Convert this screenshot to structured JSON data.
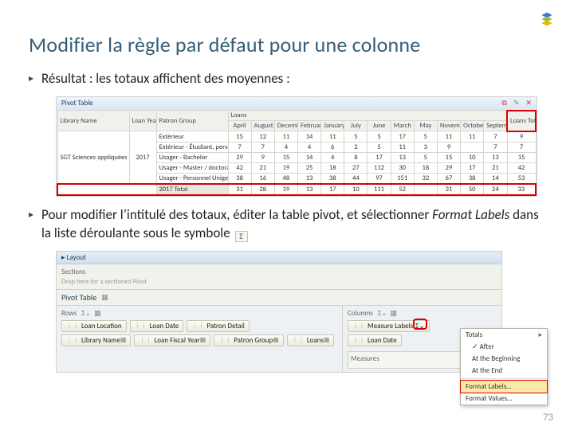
{
  "title": "Modifier la règle par défaut pour une colonne",
  "page_number": "73",
  "bullets": {
    "b1": "Résultat : les totaux affichent des moyennes :",
    "b2_a": "Pour modifier l’intitulé des totaux, éditer la table pivot, et sélectionner ",
    "b2_i": "Format Labels",
    "b2_b": " dans la liste déroulante sous le symbole"
  },
  "fig1": {
    "toolbar_title": "Pivot Table",
    "colhead_library": "Library Name",
    "colhead_year": "Loan Year",
    "colhead_group": "Patron Group",
    "colhead_loans": "Loans",
    "months": [
      "April",
      "August",
      "December",
      "February",
      "January",
      "July",
      "June",
      "March",
      "May",
      "November",
      "October",
      "Septembe"
    ],
    "total_label": "Loans Total",
    "row_lib": "SGT Sciences appliquées et",
    "row_year": "2017",
    "groups": [
      "Extérieur",
      "Extérieur - Étudiant, personne",
      "Usager - Bachelor",
      "Usager - Master / doctorat",
      "Usager - Personnel Unige / HES"
    ],
    "data": [
      [
        15,
        12,
        11,
        14,
        11,
        5,
        5,
        17,
        5,
        11,
        11,
        7
      ],
      [
        7,
        7,
        4,
        4,
        6,
        2,
        5,
        11,
        3,
        9,
        "",
        7
      ],
      [
        29,
        9,
        15,
        14,
        4,
        8,
        17,
        13,
        5,
        15,
        10,
        13
      ],
      [
        42,
        21,
        19,
        25,
        18,
        27,
        112,
        30,
        18,
        29,
        17,
        21
      ],
      [
        38,
        16,
        48,
        13,
        38,
        44,
        97,
        151,
        32,
        67,
        38,
        14
      ]
    ],
    "totals_col": [
      9,
      7,
      15,
      42,
      53
    ],
    "total_row_label": "2017 Total",
    "total_row": [
      31,
      28,
      19,
      13,
      17,
      10,
      111,
      52,
      "",
      31,
      50,
      24,
      33
    ]
  },
  "fig2": {
    "layout_label": "Layout",
    "sections_label": "Sections",
    "sections_hint": "Drop here for a sectioned Pivot",
    "table_tab": "Pivot Table",
    "rows_label": "Rows",
    "row_chips_labels": [
      "Loan Location",
      "Loan Date",
      "Patron Detail"
    ],
    "row_chips_values": [
      "Library Name",
      "Loan Fiscal Year",
      "Patron Group",
      "Loans"
    ],
    "columns_label": "Columns",
    "measure_labels": "Measure Labels",
    "col_chip": "Loan Date",
    "measures_label": "Measures",
    "menu": {
      "m1": "Totals",
      "m2": "After",
      "m3": "At the Beginning",
      "m4": "At the End",
      "m5": "Format Labels…",
      "m6": "Format Values…"
    }
  }
}
